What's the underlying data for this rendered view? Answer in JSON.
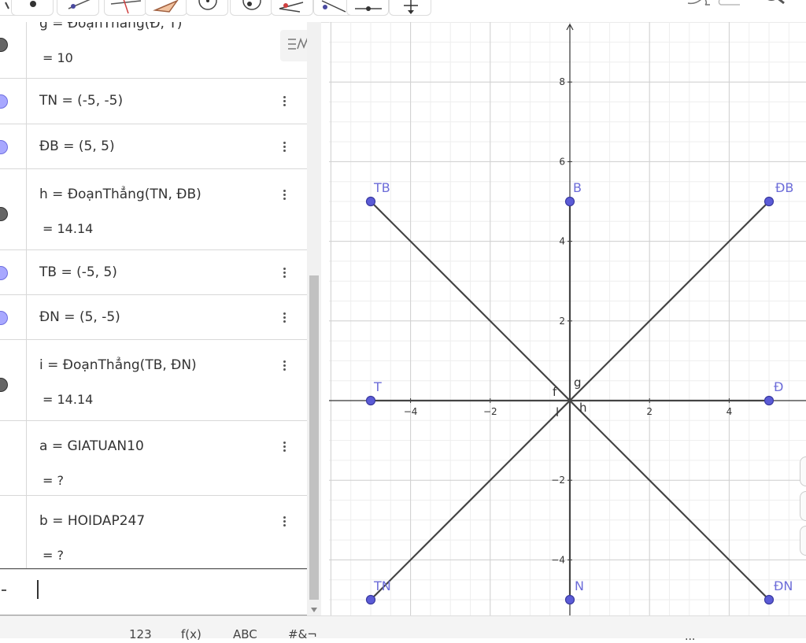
{
  "toolbar": {
    "tools": [
      {
        "name": "move-tool-icon"
      },
      {
        "name": "point-tool-icon"
      },
      {
        "name": "line-tool-icon"
      },
      {
        "name": "perpendicular-line-tool-icon"
      },
      {
        "name": "polygon-tool-icon"
      },
      {
        "name": "circle-tool-icon"
      },
      {
        "name": "circle-center-point-tool-icon"
      },
      {
        "name": "angle-tool-icon"
      },
      {
        "name": "reflect-tool-icon"
      },
      {
        "name": "slider-tool-icon"
      },
      {
        "name": "move-graphics-tool-icon"
      }
    ]
  },
  "algebra": {
    "rows": [
      {
        "marble": "seg",
        "definition": "g = ĐoạnThẳng(Đ, T)",
        "value": "= 10"
      },
      {
        "marble": "point",
        "definition": "TN = (-5, -5)",
        "value": ""
      },
      {
        "marble": "point",
        "definition": "ĐB = (5, 5)",
        "value": ""
      },
      {
        "marble": "seg",
        "definition": "h = ĐoạnThẳng(TN, ĐB)",
        "value": "= 14.14"
      },
      {
        "marble": "point",
        "definition": "TB = (-5, 5)",
        "value": ""
      },
      {
        "marble": "point",
        "definition": "ĐN = (5, -5)",
        "value": ""
      },
      {
        "marble": "seg",
        "definition": "i = ĐoạnThẳng(TB, ĐN)",
        "value": "= 14.14"
      },
      {
        "marble": "none",
        "definition": "a = GIATUAN10",
        "value": "= ?"
      },
      {
        "marble": "none",
        "definition": "b = HOIDAP247",
        "value": "= ?"
      }
    ],
    "input_value": ""
  },
  "graphics": {
    "points": [
      {
        "label": "TB",
        "x": -5,
        "y": 5
      },
      {
        "label": "B",
        "x": 0,
        "y": 5
      },
      {
        "label": "ĐB",
        "x": 5,
        "y": 5
      },
      {
        "label": "T",
        "x": -5,
        "y": 0
      },
      {
        "label": "Đ",
        "x": 5,
        "y": 0
      },
      {
        "label": "TN",
        "x": -5,
        "y": -5
      },
      {
        "label": "N",
        "x": 0,
        "y": -5
      },
      {
        "label": "ĐN",
        "x": 5,
        "y": -5
      }
    ],
    "segments": [
      {
        "label": "h",
        "from": "TN",
        "to": "ĐB"
      },
      {
        "label": "i",
        "from": "TB",
        "to": "ĐN"
      },
      {
        "label": "g",
        "from": "Đ",
        "to": "T"
      },
      {
        "label": "f",
        "from": "B",
        "to": "N"
      }
    ],
    "segment_labels": [
      "g",
      "f",
      "h",
      "l"
    ],
    "x_ticks": [
      -4,
      -2,
      2,
      4
    ],
    "y_ticks": [
      8,
      6,
      4,
      2,
      -2,
      -4
    ],
    "x_tick_labels": [
      "−4",
      "−2",
      "2",
      "4"
    ],
    "y_tick_labels": [
      "8",
      "6",
      "4",
      "2",
      "−2",
      "−4"
    ],
    "x_range": [
      -6,
      6
    ],
    "y_range": [
      -5.3,
      9.5
    ],
    "grid": true,
    "colors": {
      "point_fill": "#5b5bd6",
      "point_stroke": "#3a3aa0",
      "label": "#6c6cd8",
      "segment": "#444444"
    }
  },
  "keyboard": {
    "tabs": [
      "123",
      "f(x)",
      "ABC",
      "#&¬"
    ],
    "more": "..."
  }
}
